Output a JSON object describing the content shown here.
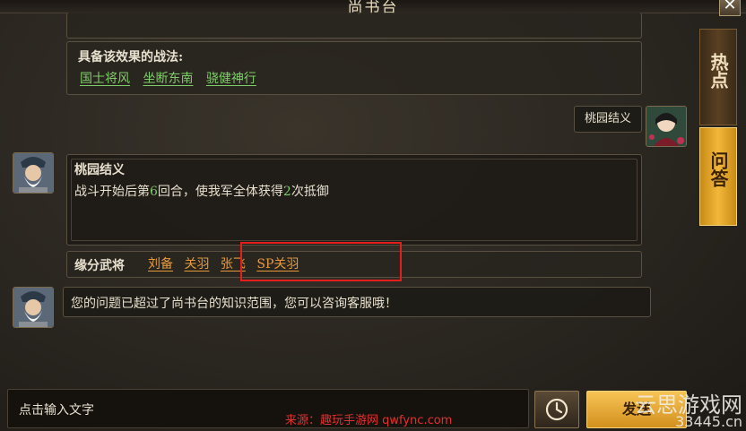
{
  "window": {
    "title": "尚书台",
    "close_label": "✕"
  },
  "tabs": [
    {
      "label": "热点"
    },
    {
      "label": "问答"
    }
  ],
  "tactics_panel": {
    "heading": "具备该效果的战法:",
    "links": [
      "国士将风",
      "坐断东南",
      "骁健神行"
    ]
  },
  "user_message": {
    "text": "桃园结义"
  },
  "answer": {
    "title": "桃园结义",
    "desc_prefix": "战斗开始后第",
    "desc_round": "6",
    "desc_mid": "回合，使我军全体获得",
    "desc_count": "2",
    "desc_suffix": "次抵御",
    "fate_label": "缘分武将",
    "fate_generals": [
      "刘备",
      "关羽",
      "张飞",
      "SP关羽"
    ]
  },
  "bot_limit_message": {
    "text": "您的问题已超过了尚书台的知识范围，您可以咨询客服哦！"
  },
  "input": {
    "placeholder": "点击输入文字"
  },
  "send_button": {
    "label": "发送"
  },
  "watermarks": {
    "source": "来源：趣玩手游网 qwfync.com",
    "site_name": "云思游戏网",
    "site_domain": "33445.cn"
  },
  "colors": {
    "gold": "#f0c244",
    "green_link": "#7fcc6a",
    "orange_link": "#e89a3a",
    "highlight_red": "#e51d1d"
  }
}
